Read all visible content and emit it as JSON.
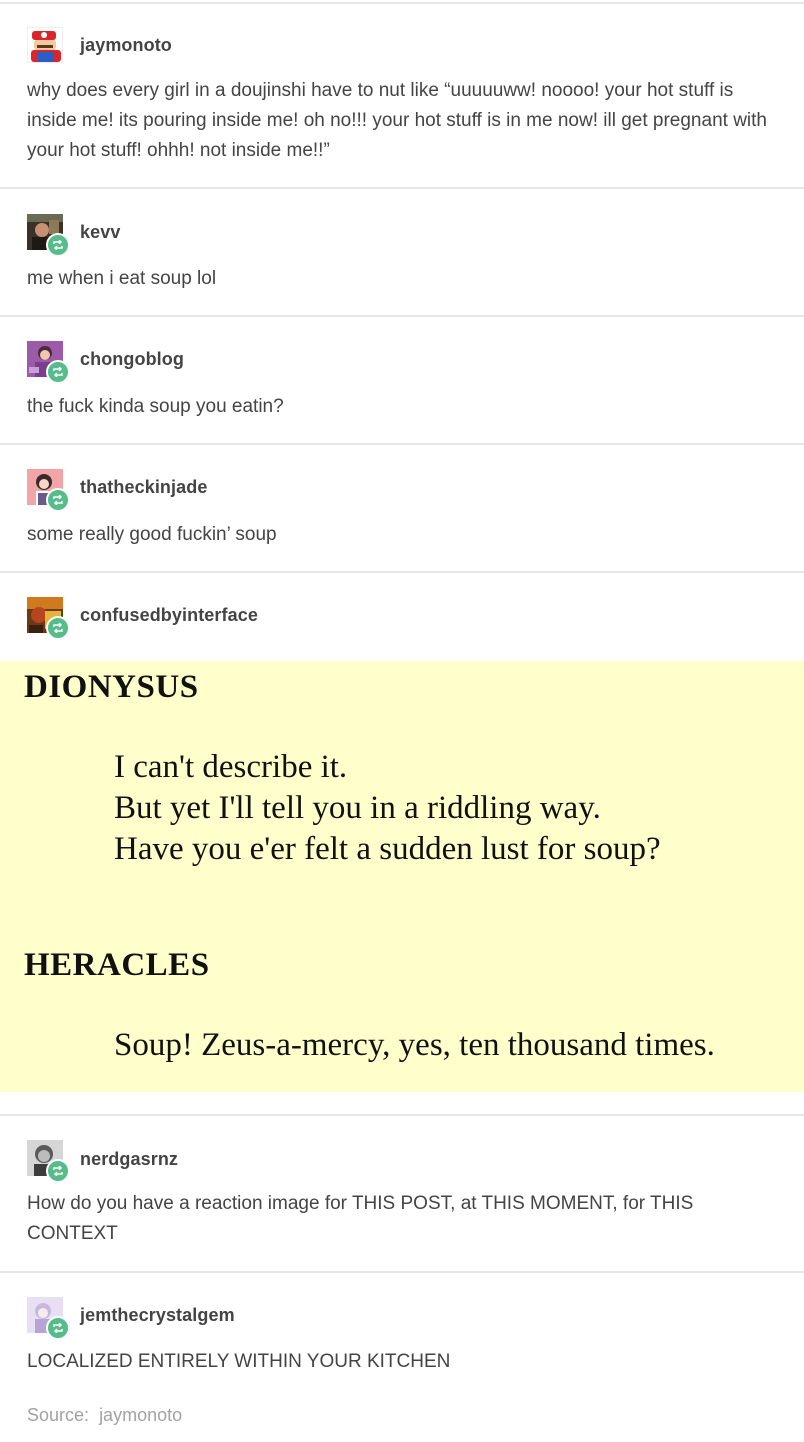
{
  "posts": [
    {
      "username": "jaymonoto",
      "text": "why does every girl in a doujinshi have to nut like “uuuuuww! noooo! your hot stuff is inside me! its pouring inside me! oh no!!! your hot stuff is in me now! ill get pregnant with your hot stuff! ohhh! not inside me!!”"
    },
    {
      "username": "kevv",
      "text": "me when i eat soup lol"
    },
    {
      "username": "chongoblog",
      "text": "the fuck kinda soup you eatin?"
    },
    {
      "username": "thatheckinjade",
      "text": "some really good fuckin’ soup"
    },
    {
      "username": "confusedbyinterface",
      "text": ""
    },
    {
      "username": "nerdgasrnz",
      "text": "How do you have a reaction image for THIS POST, at THIS MOMENT, for THIS CONTEXT"
    },
    {
      "username": "jemthecrystalgem",
      "text": "LOCALIZED ENTIRELY WITHIN YOUR KITCHEN"
    }
  ],
  "quote": {
    "speaker1": "DIONYSUS",
    "lines1": [
      "I can't describe it.",
      "But yet I'll tell you in a riddling way.",
      "Have you e'er felt a sudden lust for soup?"
    ],
    "speaker2": "HERACLES",
    "lines2": [
      "Soup! Zeus-a-mercy, yes, ten thousand times."
    ],
    "background": "#ffffcc"
  },
  "source": {
    "label": "Source:",
    "name": "jaymonoto"
  },
  "colors": {
    "reblog_badge": "#56bc8a",
    "text": "#444444",
    "divider": "#e6e6e6"
  },
  "icons": {
    "reblog": "reblog-icon"
  }
}
